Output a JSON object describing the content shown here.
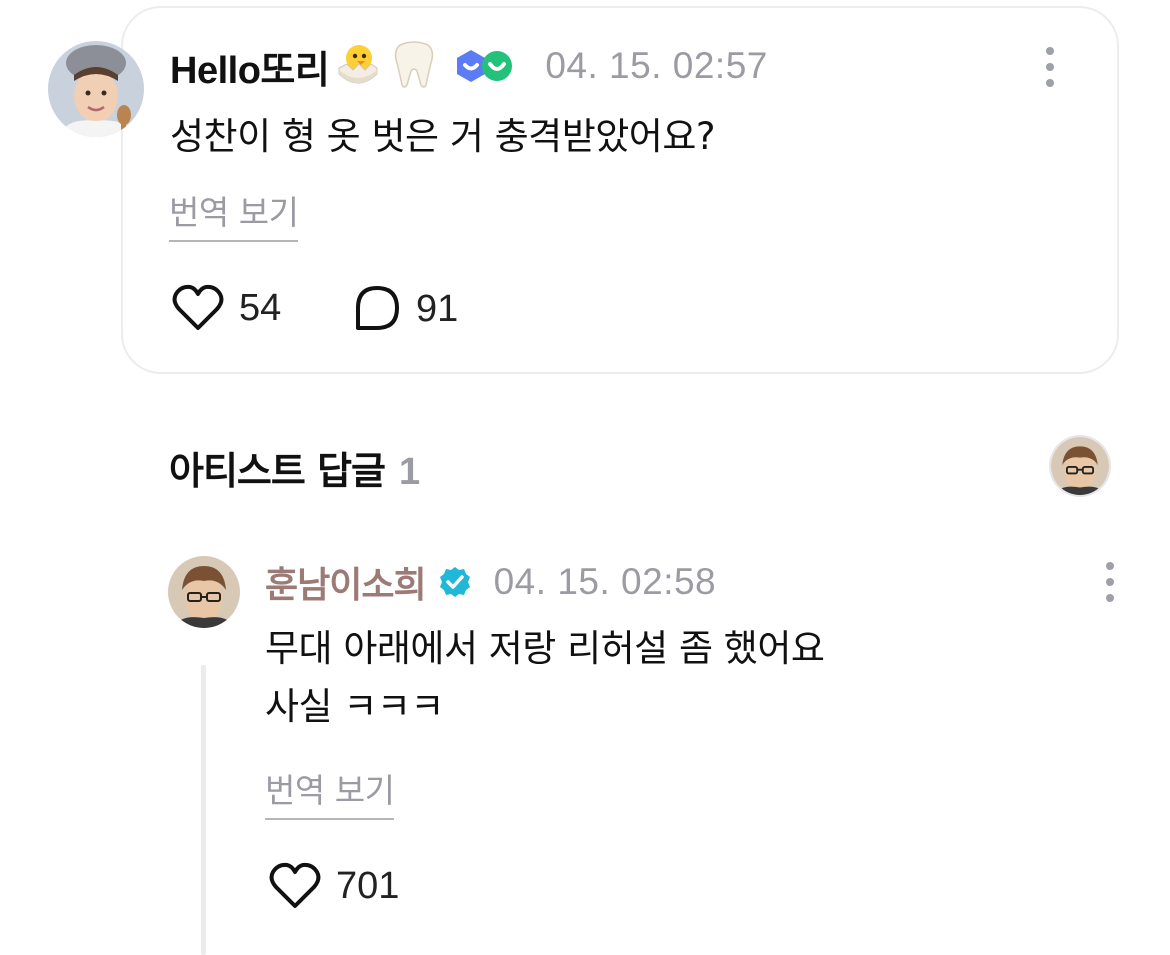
{
  "comment": {
    "author": "Hello또리",
    "author_emojis": [
      "hatching-chick-emoji",
      "tooth-emoji"
    ],
    "badges": [
      "blue-membership-badge-icon",
      "green-membership-badge-icon"
    ],
    "timestamp": "04. 15. 02:57",
    "text": "성찬이 형 옷 벗은 거 충격받았어요?",
    "translate_label": "번역 보기",
    "likes": "54",
    "replies": "91"
  },
  "artist_replies": {
    "title": "아티스트 답글",
    "count": "1"
  },
  "reply": {
    "author": "훈남이소희",
    "verified_icon": "verified-check-icon",
    "timestamp": "04. 15. 02:58",
    "text_lines": [
      "무대 아래에서 저랑 리허설 좀 했어요",
      "사실 ㅋㅋㅋ"
    ],
    "translate_label": "번역 보기",
    "likes": "701"
  },
  "colors": {
    "artist_name": "#9c7b76",
    "muted": "#9a9ba3",
    "verified": "#1fb8d8",
    "badge_blue": "#5b7cf5",
    "badge_green": "#23c17a",
    "card_border": "#ececef"
  }
}
